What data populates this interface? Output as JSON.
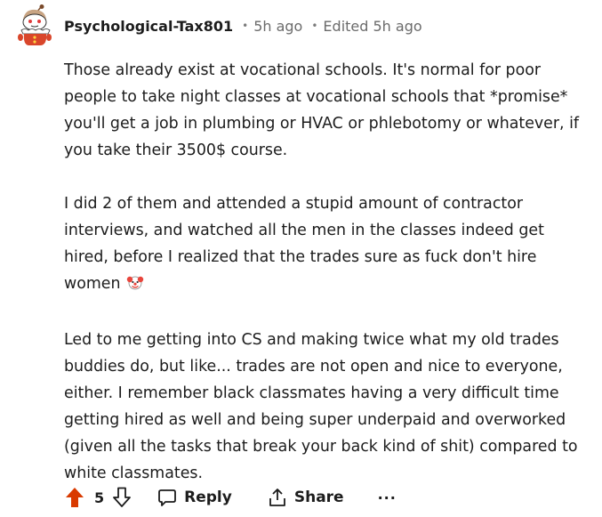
{
  "comment": {
    "author": "Psychological-Tax801",
    "separator": "•",
    "time": "5h ago",
    "separator2": "•",
    "edited": "Edited 5h ago",
    "paragraphs": [
      "Those already exist at vocational schools. It's normal for poor people to take night classes at vocational schools that *promise* you'll get a job in plumbing or HVAC or phlebotomy or whatever, if you take their 3500$ course.",
      "I did 2 of them and attended a stupid amount of contractor interviews, and watched all the men in the classes indeed get hired, before I realized that the trades sure as fuck don't hire women",
      "Led to me getting into CS and making twice what my old trades buddies do, but like... trades are not open and nice to everyone, either. I remember black classmates having a very difficult time getting hired as well and being super underpaid and overworked (given all the tasks that break your back kind of shit) compared to white classmates."
    ],
    "emoji_icon": "clown-face-emoji-icon"
  },
  "actions": {
    "score": "5",
    "upvote_state": "upvoted",
    "reply_label": "Reply",
    "share_label": "Share",
    "more_label": "···"
  },
  "colors": {
    "upvote_active": "#d93a00",
    "text": "#1c1c1c",
    "meta": "#6b6b6b"
  }
}
